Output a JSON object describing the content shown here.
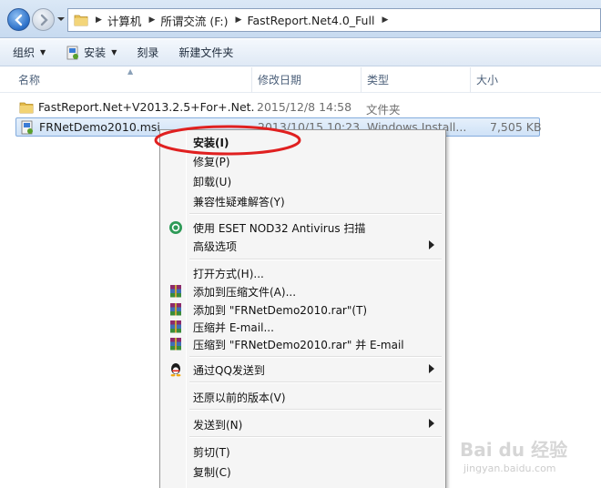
{
  "address_bar": {
    "crumbs": [
      "计算机",
      "所谓交流 (F:)",
      "FastReport.Net4.0_Full"
    ]
  },
  "toolbar": {
    "organize_label": "组织",
    "install_label": "安装",
    "burn_label": "刻录",
    "new_folder_label": "新建文件夹"
  },
  "columns": {
    "name": "名称",
    "date": "修改日期",
    "type": "类型",
    "size": "大小"
  },
  "files": [
    {
      "name": "FastReport.Net+V2013.2.5+For+.Net...",
      "date": "2015/12/8 14:58",
      "type": "文件夹",
      "size": ""
    },
    {
      "name": "FRNetDemo2010.msi",
      "date": "2013/10/15 10:23",
      "type": "Windows Install...",
      "size": "7,505 KB"
    }
  ],
  "context_menu": {
    "install": "安装(I)",
    "repair": "修复(P)",
    "uninstall": "卸载(U)",
    "compat": "兼容性疑难解答(Y)",
    "eset_scan": "使用 ESET NOD32 Antivirus 扫描",
    "advanced": "高级选项",
    "open_with": "打开方式(H)...",
    "add_archive": "添加到压缩文件(A)...",
    "add_rar": "添加到 \"FRNetDemo2010.rar\"(T)",
    "compress_email": "压缩并 E-mail...",
    "compress_rar_email": "压缩到 \"FRNetDemo2010.rar\" 并 E-mail",
    "send_qq": "通过QQ发送到",
    "restore": "还原以前的版本(V)",
    "send_to": "发送到(N)",
    "cut": "剪切(T)",
    "copy": "复制(C)"
  },
  "watermark": {
    "brand": "Bai du 经验",
    "url": "jingyan.baidu.com"
  },
  "colors": {
    "selection": "#cfe2f7",
    "annotation": "#e02020",
    "menu_bg": "#f5f5f5"
  },
  "icons": {
    "back": "back-arrow-icon",
    "forward": "forward-arrow-icon",
    "folder": "folder-icon",
    "msi": "installer-icon",
    "eset": "eset-icon",
    "winrar": "winrar-icon",
    "qq": "qq-icon"
  }
}
